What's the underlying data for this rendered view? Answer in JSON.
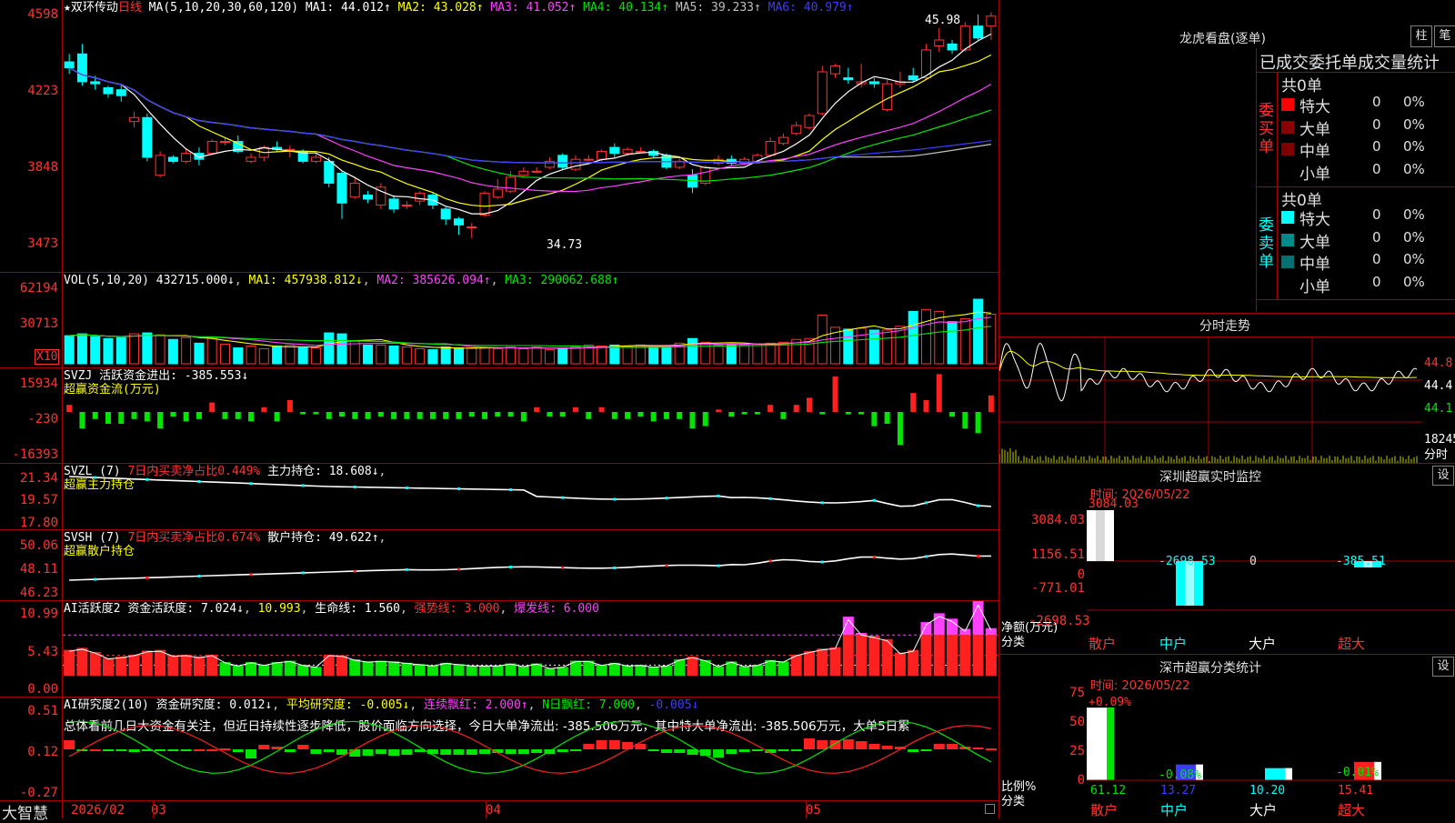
{
  "main_chart": {
    "stock_name": "★双环传动",
    "period": "日线",
    "ma_label": "MA(5,10,20,30,60,120)",
    "ma": [
      {
        "label": "MA1: 44.012↑",
        "color": "#ffffff"
      },
      {
        "label": "MA2: 43.028↑",
        "color": "#ffff00"
      },
      {
        "label": "MA3: 41.052↑",
        "color": "#ff40ff"
      },
      {
        "label": "MA4: 40.134↑",
        "color": "#00e600"
      },
      {
        "label": "MA5: 39.233↑",
        "color": "#c0c0c0"
      },
      {
        "label": "MA6: 40.979↑",
        "color": "#3c3cff"
      }
    ],
    "y_ticks": [
      "4598",
      "4223",
      "3848",
      "3473"
    ],
    "high_label": "45.98",
    "low_label": "34.73"
  },
  "vol_panel": {
    "title": "VOL(5,10,20)",
    "value": "432715.000↓",
    "ma1": "MA1: 457938.812↓",
    "ma2": "MA2: 385626.094↑",
    "ma3": "MA3: 290062.688↑",
    "y_ticks": [
      "62194",
      "30713"
    ],
    "unit": "X10"
  },
  "svzj_panel": {
    "title": "SVZJ",
    "label": "活跃资金进出: -385.553↓",
    "subtitle": "超赢资金流(万元)",
    "y_ticks": [
      "15934",
      "-230",
      "-16393"
    ]
  },
  "svzl_panel": {
    "title": "SVZL (7)",
    "label1": "7日内买卖净占比0.449%",
    "label2": "主力持仓: 18.608↓",
    "subtitle": "超赢主力持仓",
    "y_ticks": [
      "21.34",
      "19.57",
      "17.80"
    ]
  },
  "svsh_panel": {
    "title": "SVSH (7)",
    "label1": "7日内买卖净占比0.674%",
    "label2": "散户持仓: 49.622↑",
    "subtitle": "超赢散户持仓",
    "y_ticks": [
      "50.06",
      "48.11",
      "46.23"
    ]
  },
  "ai_active_panel": {
    "title": "AI活跃度2",
    "label1": "资金活跃度: 7.024↓",
    "label2": "10.993",
    "label3": "生命线: 1.560",
    "label4": "强势线: 3.000",
    "label5": "爆发线: 6.000",
    "y_ticks": [
      "10.99",
      "5.43",
      "0.00"
    ]
  },
  "ai_research_panel": {
    "title": "AI研究度2(10)",
    "label1": "资金研究度: 0.012↓",
    "label2": "平均研究度: -0.005↓",
    "label3": "连续飘红: 2.000↑",
    "label4": "N日飘红: 7.000",
    "label5": "-0.005↓",
    "description": "总体看前几日大资金有关注，但近日持续性逐步降低，股价面临方向选择，今日大单净流出: -385.506万元，其中特大单净流出: -385.506万元，大单5日累",
    "y_ticks": [
      "0.51",
      "0.12",
      "-0.27"
    ]
  },
  "x_axis": {
    "logo": "大智慧",
    "labels": [
      "2026/02",
      "03",
      "04",
      "05"
    ]
  },
  "right_panel": {
    "title": "龙虎看盘(逐单)",
    "btn1": "柱",
    "btn2": "笔",
    "stats_header": "已成交委托单成交量统计",
    "buy_side": "委买单",
    "sell_side": "委卖单",
    "buy_total": "共0单",
    "sell_total": "共0单",
    "categories": [
      "特大",
      "大单",
      "中单",
      "小单"
    ],
    "buy_rows": [
      {
        "name": "特大",
        "count": "0",
        "pct": "0%",
        "color": "#ff0000"
      },
      {
        "name": "大单",
        "count": "0",
        "pct": "0%",
        "color": "#8b0000"
      },
      {
        "name": "中单",
        "count": "0",
        "pct": "0%",
        "color": "#800000"
      },
      {
        "name": "小单",
        "count": "0",
        "pct": "0%",
        "color": ""
      }
    ],
    "sell_rows": [
      {
        "name": "特大",
        "count": "0",
        "pct": "0%",
        "color": "#00ffff"
      },
      {
        "name": "大单",
        "count": "0",
        "pct": "0%",
        "color": "#008b8b"
      },
      {
        "name": "中单",
        "count": "0",
        "pct": "0%",
        "color": "#007070"
      },
      {
        "name": "小单",
        "count": "0",
        "pct": "0%",
        "color": ""
      }
    ],
    "intraday_title": "分时走势",
    "intraday_ticks": [
      "44.8",
      "44.4",
      "44.1"
    ],
    "intraday_vol": "18245",
    "intraday_vol_label": "分时"
  },
  "monitor": {
    "title": "深圳超赢实时监控",
    "setting": "设",
    "time": "时间: 2026/05/22",
    "y_ticks": [
      "3084.03",
      "1156.51",
      "0",
      "-771.01",
      "-2698.53"
    ],
    "y_label1": "净额(万元)",
    "y_label2": "分类",
    "bar_values": [
      "3084.03",
      "-2698.53",
      "0",
      "-385.51"
    ],
    "bar_categories": [
      "散户",
      "中户",
      "大户",
      "超大"
    ]
  },
  "classify": {
    "title": "深市超赢分类统计",
    "setting": "设",
    "time": "时间: 2026/05/22",
    "y_ticks": [
      "75",
      "50",
      "25",
      "0"
    ],
    "y_label1": "比例%",
    "y_label2": "分类",
    "changes": [
      "+0.09%",
      "-0.08%",
      "",
      "-0.01%"
    ],
    "values": [
      "61.12",
      "13.27",
      "10.20",
      "15.41"
    ],
    "categories": [
      "散户",
      "中户",
      "大户",
      "超大"
    ]
  },
  "chart_data": [
    {
      "type": "candlestick",
      "title": "双环传动 日线",
      "ylim": [
        34.73,
        45.98
      ],
      "values": [
        {
          "o": 43.6,
          "c": 43.3,
          "h": 44.0,
          "l": 43.0
        },
        {
          "o": 44.0,
          "c": 42.6,
          "h": 44.5,
          "l": 42.4
        },
        {
          "o": 42.6,
          "c": 42.5,
          "h": 42.9,
          "l": 42.2
        },
        {
          "o": 42.3,
          "c": 42.0,
          "h": 42.4,
          "l": 41.8
        },
        {
          "o": 42.2,
          "c": 41.9,
          "h": 42.5,
          "l": 41.6
        },
        {
          "o": 40.6,
          "c": 40.8,
          "h": 41.1,
          "l": 40.3
        },
        {
          "o": 40.8,
          "c": 38.8,
          "h": 41.0,
          "l": 38.6
        },
        {
          "o": 37.9,
          "c": 38.9,
          "h": 39.1,
          "l": 37.8
        },
        {
          "o": 38.8,
          "c": 38.6,
          "h": 38.9,
          "l": 38.5
        },
        {
          "o": 38.6,
          "c": 39.0,
          "h": 39.2,
          "l": 38.5
        },
        {
          "o": 39.0,
          "c": 38.7,
          "h": 39.3,
          "l": 38.4
        },
        {
          "o": 39.0,
          "c": 39.6,
          "h": 39.7,
          "l": 38.9
        },
        {
          "o": 39.6,
          "c": 39.6,
          "h": 39.8,
          "l": 39.4
        },
        {
          "o": 39.6,
          "c": 39.1,
          "h": 39.9,
          "l": 39.0
        },
        {
          "o": 38.6,
          "c": 38.8,
          "h": 39.0,
          "l": 38.5
        },
        {
          "o": 38.8,
          "c": 39.3,
          "h": 39.4,
          "l": 38.6
        },
        {
          "o": 39.3,
          "c": 39.2,
          "h": 39.6,
          "l": 39.1
        },
        {
          "o": 39.2,
          "c": 39.2,
          "h": 39.4,
          "l": 38.8
        },
        {
          "o": 39.1,
          "c": 38.6,
          "h": 39.2,
          "l": 38.5
        },
        {
          "o": 38.6,
          "c": 38.8,
          "h": 39.0,
          "l": 38.5
        },
        {
          "o": 38.6,
          "c": 37.5,
          "h": 38.8,
          "l": 37.3
        },
        {
          "o": 38.0,
          "c": 36.5,
          "h": 38.1,
          "l": 35.7
        },
        {
          "o": 36.8,
          "c": 37.5,
          "h": 37.8,
          "l": 36.7
        },
        {
          "o": 36.9,
          "c": 36.7,
          "h": 37.1,
          "l": 36.5
        },
        {
          "o": 36.4,
          "c": 37.3,
          "h": 37.5,
          "l": 36.2
        },
        {
          "o": 36.7,
          "c": 36.2,
          "h": 36.9,
          "l": 36.0
        },
        {
          "o": 36.4,
          "c": 36.4,
          "h": 36.6,
          "l": 36.2
        },
        {
          "o": 36.6,
          "c": 37.0,
          "h": 37.1,
          "l": 36.4
        },
        {
          "o": 36.9,
          "c": 36.4,
          "h": 37.0,
          "l": 36.2
        },
        {
          "o": 36.2,
          "c": 35.7,
          "h": 36.3,
          "l": 35.4
        },
        {
          "o": 35.7,
          "c": 35.4,
          "h": 35.8,
          "l": 34.9
        },
        {
          "o": 35.3,
          "c": 35.3,
          "h": 35.5,
          "l": 34.73
        },
        {
          "o": 35.9,
          "c": 37.0,
          "h": 37.1,
          "l": 35.8
        },
        {
          "o": 36.8,
          "c": 37.2,
          "h": 37.7,
          "l": 36.7
        },
        {
          "o": 37.1,
          "c": 37.8,
          "h": 38.1,
          "l": 37.0
        },
        {
          "o": 37.9,
          "c": 38.1,
          "h": 38.3,
          "l": 37.8
        },
        {
          "o": 38.1,
          "c": 38.1,
          "h": 38.3,
          "l": 38.0
        },
        {
          "o": 38.3,
          "c": 38.6,
          "h": 38.8,
          "l": 38.2
        },
        {
          "o": 38.9,
          "c": 38.3,
          "h": 39.0,
          "l": 38.2
        },
        {
          "o": 38.2,
          "c": 38.7,
          "h": 38.9,
          "l": 38.1
        },
        {
          "o": 38.7,
          "c": 38.7,
          "h": 38.9,
          "l": 38.6
        },
        {
          "o": 38.7,
          "c": 39.1,
          "h": 39.2,
          "l": 38.6
        },
        {
          "o": 39.3,
          "c": 39.0,
          "h": 39.5,
          "l": 38.8
        },
        {
          "o": 39.0,
          "c": 39.2,
          "h": 39.3,
          "l": 38.9
        },
        {
          "o": 39.1,
          "c": 39.1,
          "h": 39.3,
          "l": 39.0
        },
        {
          "o": 39.1,
          "c": 38.9,
          "h": 39.2,
          "l": 38.8
        },
        {
          "o": 38.9,
          "c": 38.3,
          "h": 39.0,
          "l": 38.2
        },
        {
          "o": 38.3,
          "c": 38.6,
          "h": 38.8,
          "l": 38.2
        },
        {
          "o": 37.9,
          "c": 37.3,
          "h": 38.2,
          "l": 37.0
        },
        {
          "o": 37.5,
          "c": 38.3,
          "h": 38.4,
          "l": 37.4
        },
        {
          "o": 38.5,
          "c": 38.7,
          "h": 38.9,
          "l": 38.4
        },
        {
          "o": 38.7,
          "c": 38.5,
          "h": 38.9,
          "l": 38.4
        },
        {
          "o": 38.5,
          "c": 38.7,
          "h": 38.8,
          "l": 38.4
        },
        {
          "o": 38.6,
          "c": 38.9,
          "h": 39.0,
          "l": 38.5
        },
        {
          "o": 38.9,
          "c": 39.6,
          "h": 39.8,
          "l": 38.8
        },
        {
          "o": 39.5,
          "c": 39.8,
          "h": 40.0,
          "l": 39.4
        },
        {
          "o": 40.0,
          "c": 40.4,
          "h": 40.6,
          "l": 39.9
        },
        {
          "o": 40.3,
          "c": 40.9,
          "h": 41.0,
          "l": 40.2
        },
        {
          "o": 41.0,
          "c": 43.1,
          "h": 43.4,
          "l": 40.9
        },
        {
          "o": 43.0,
          "c": 43.4,
          "h": 43.5,
          "l": 42.8
        },
        {
          "o": 42.8,
          "c": 42.7,
          "h": 43.3,
          "l": 42.5
        },
        {
          "o": 42.5,
          "c": 42.6,
          "h": 43.5,
          "l": 42.3
        },
        {
          "o": 42.6,
          "c": 42.5,
          "h": 42.8,
          "l": 42.3
        },
        {
          "o": 41.2,
          "c": 42.5,
          "h": 42.7,
          "l": 41.1
        },
        {
          "o": 42.5,
          "c": 42.6,
          "h": 43.1,
          "l": 42.3
        },
        {
          "o": 42.9,
          "c": 42.7,
          "h": 43.3,
          "l": 42.6
        },
        {
          "o": 42.8,
          "c": 44.2,
          "h": 44.5,
          "l": 42.7
        },
        {
          "o": 44.4,
          "c": 44.7,
          "h": 45.3,
          "l": 44.1
        },
        {
          "o": 44.5,
          "c": 44.2,
          "h": 44.7,
          "l": 44.0
        },
        {
          "o": 44.2,
          "c": 45.4,
          "h": 45.6,
          "l": 44.1
        },
        {
          "o": 45.4,
          "c": 44.8,
          "h": 45.98,
          "l": 44.7
        },
        {
          "o": 45.4,
          "c": 45.9,
          "h": 46.1,
          "l": 44.7
        }
      ]
    },
    {
      "type": "bar",
      "title": "VOL(5,10,20)",
      "values": [
        30,
        32,
        29,
        27,
        28,
        32,
        33,
        31,
        26,
        28,
        22,
        28,
        21,
        17,
        19,
        16,
        19,
        20,
        17,
        17,
        33,
        32,
        24,
        20,
        20,
        19,
        18,
        16,
        15,
        18,
        17,
        17,
        17,
        16,
        18,
        16,
        18,
        15,
        16,
        18,
        20,
        19,
        20,
        19,
        20,
        19,
        19,
        22,
        27,
        23,
        20,
        21,
        20,
        21,
        22,
        23,
        26,
        27,
        52,
        39,
        37,
        38,
        36,
        36,
        40,
        56,
        58,
        56,
        45,
        48,
        69,
        53
      ]
    },
    {
      "type": "bar",
      "title": "SVZJ 活跃资金进出",
      "values": [
        3,
        -7,
        -3,
        -5,
        -5,
        -3,
        -4,
        -7,
        -2,
        -4,
        -3,
        4,
        -3,
        -3,
        -4,
        2,
        -4,
        5,
        -1,
        -1,
        -3,
        -2,
        -3,
        -3,
        -2,
        -3,
        -3,
        -3,
        -3,
        -3,
        -3,
        -2,
        -3,
        -2,
        -2,
        -4,
        2,
        -2,
        -2,
        2,
        -3,
        2,
        -3,
        -3,
        -2,
        -4,
        -3,
        -3,
        -7,
        -6,
        1,
        -2,
        -1,
        -1,
        3,
        -3,
        3,
        6,
        -1,
        15,
        -1,
        -1,
        -6,
        -5,
        -14,
        8,
        5,
        16,
        -2,
        -7,
        -9,
        7,
        -1
      ]
    },
    {
      "type": "bar",
      "title": "AI活跃度2",
      "values": [
        3.8,
        4.1,
        3.5,
        2.6,
        2.8,
        3.1,
        3.7,
        3.8,
        3.0,
        3.1,
        2.8,
        3.1,
        2.0,
        1.5,
        2.0,
        1.6,
        2.0,
        2.2,
        1.6,
        1.3,
        3.1,
        3.0,
        2.4,
        2.1,
        2.2,
        2.1,
        1.9,
        1.7,
        1.5,
        1.9,
        1.7,
        1.5,
        1.5,
        1.5,
        1.8,
        1.4,
        1.8,
        1.1,
        1.3,
        2.2,
        2.2,
        1.6,
        1.9,
        1.5,
        1.6,
        1.3,
        1.5,
        2.4,
        2.8,
        2.3,
        1.4,
        2.1,
        1.4,
        1.6,
        2.3,
        2.1,
        3.1,
        3.6,
        4.0,
        4.2,
        8.7,
        6.3,
        5.9,
        5.4,
        3.4,
        3.8,
        7.9,
        9.2,
        8.4,
        6.9,
        10.99,
        7.0
      ]
    },
    {
      "type": "bar",
      "title": "AI研究度2(10)",
      "values": [
        0.1,
        -0.02,
        0.0,
        -0.01,
        -0.02,
        -0.03,
        -0.02,
        -0.02,
        -0.02,
        -0.01,
        0.0,
        0.0,
        0.01,
        -0.03,
        -0.1,
        0.05,
        0.03,
        -0.03,
        0.05,
        -0.05,
        -0.03,
        -0.06,
        -0.08,
        -0.07,
        -0.05,
        -0.07,
        -0.06,
        -0.03,
        -0.05,
        -0.06,
        -0.06,
        -0.06,
        -0.05,
        -0.04,
        -0.05,
        -0.05,
        -0.04,
        -0.05,
        -0.03,
        -0.01,
        0.06,
        0.1,
        0.1,
        0.08,
        0.06,
        -0.01,
        -0.04,
        -0.04,
        -0.06,
        -0.07,
        -0.09,
        -0.05,
        -0.03,
        -0.02,
        -0.04,
        -0.02,
        -0.01,
        0.12,
        0.1,
        0.1,
        0.11,
        0.09,
        0.06,
        0.04,
        0.03,
        -0.03,
        -0.02,
        0.06,
        0.06,
        0.03,
        0.02,
        0.01
      ]
    }
  ]
}
